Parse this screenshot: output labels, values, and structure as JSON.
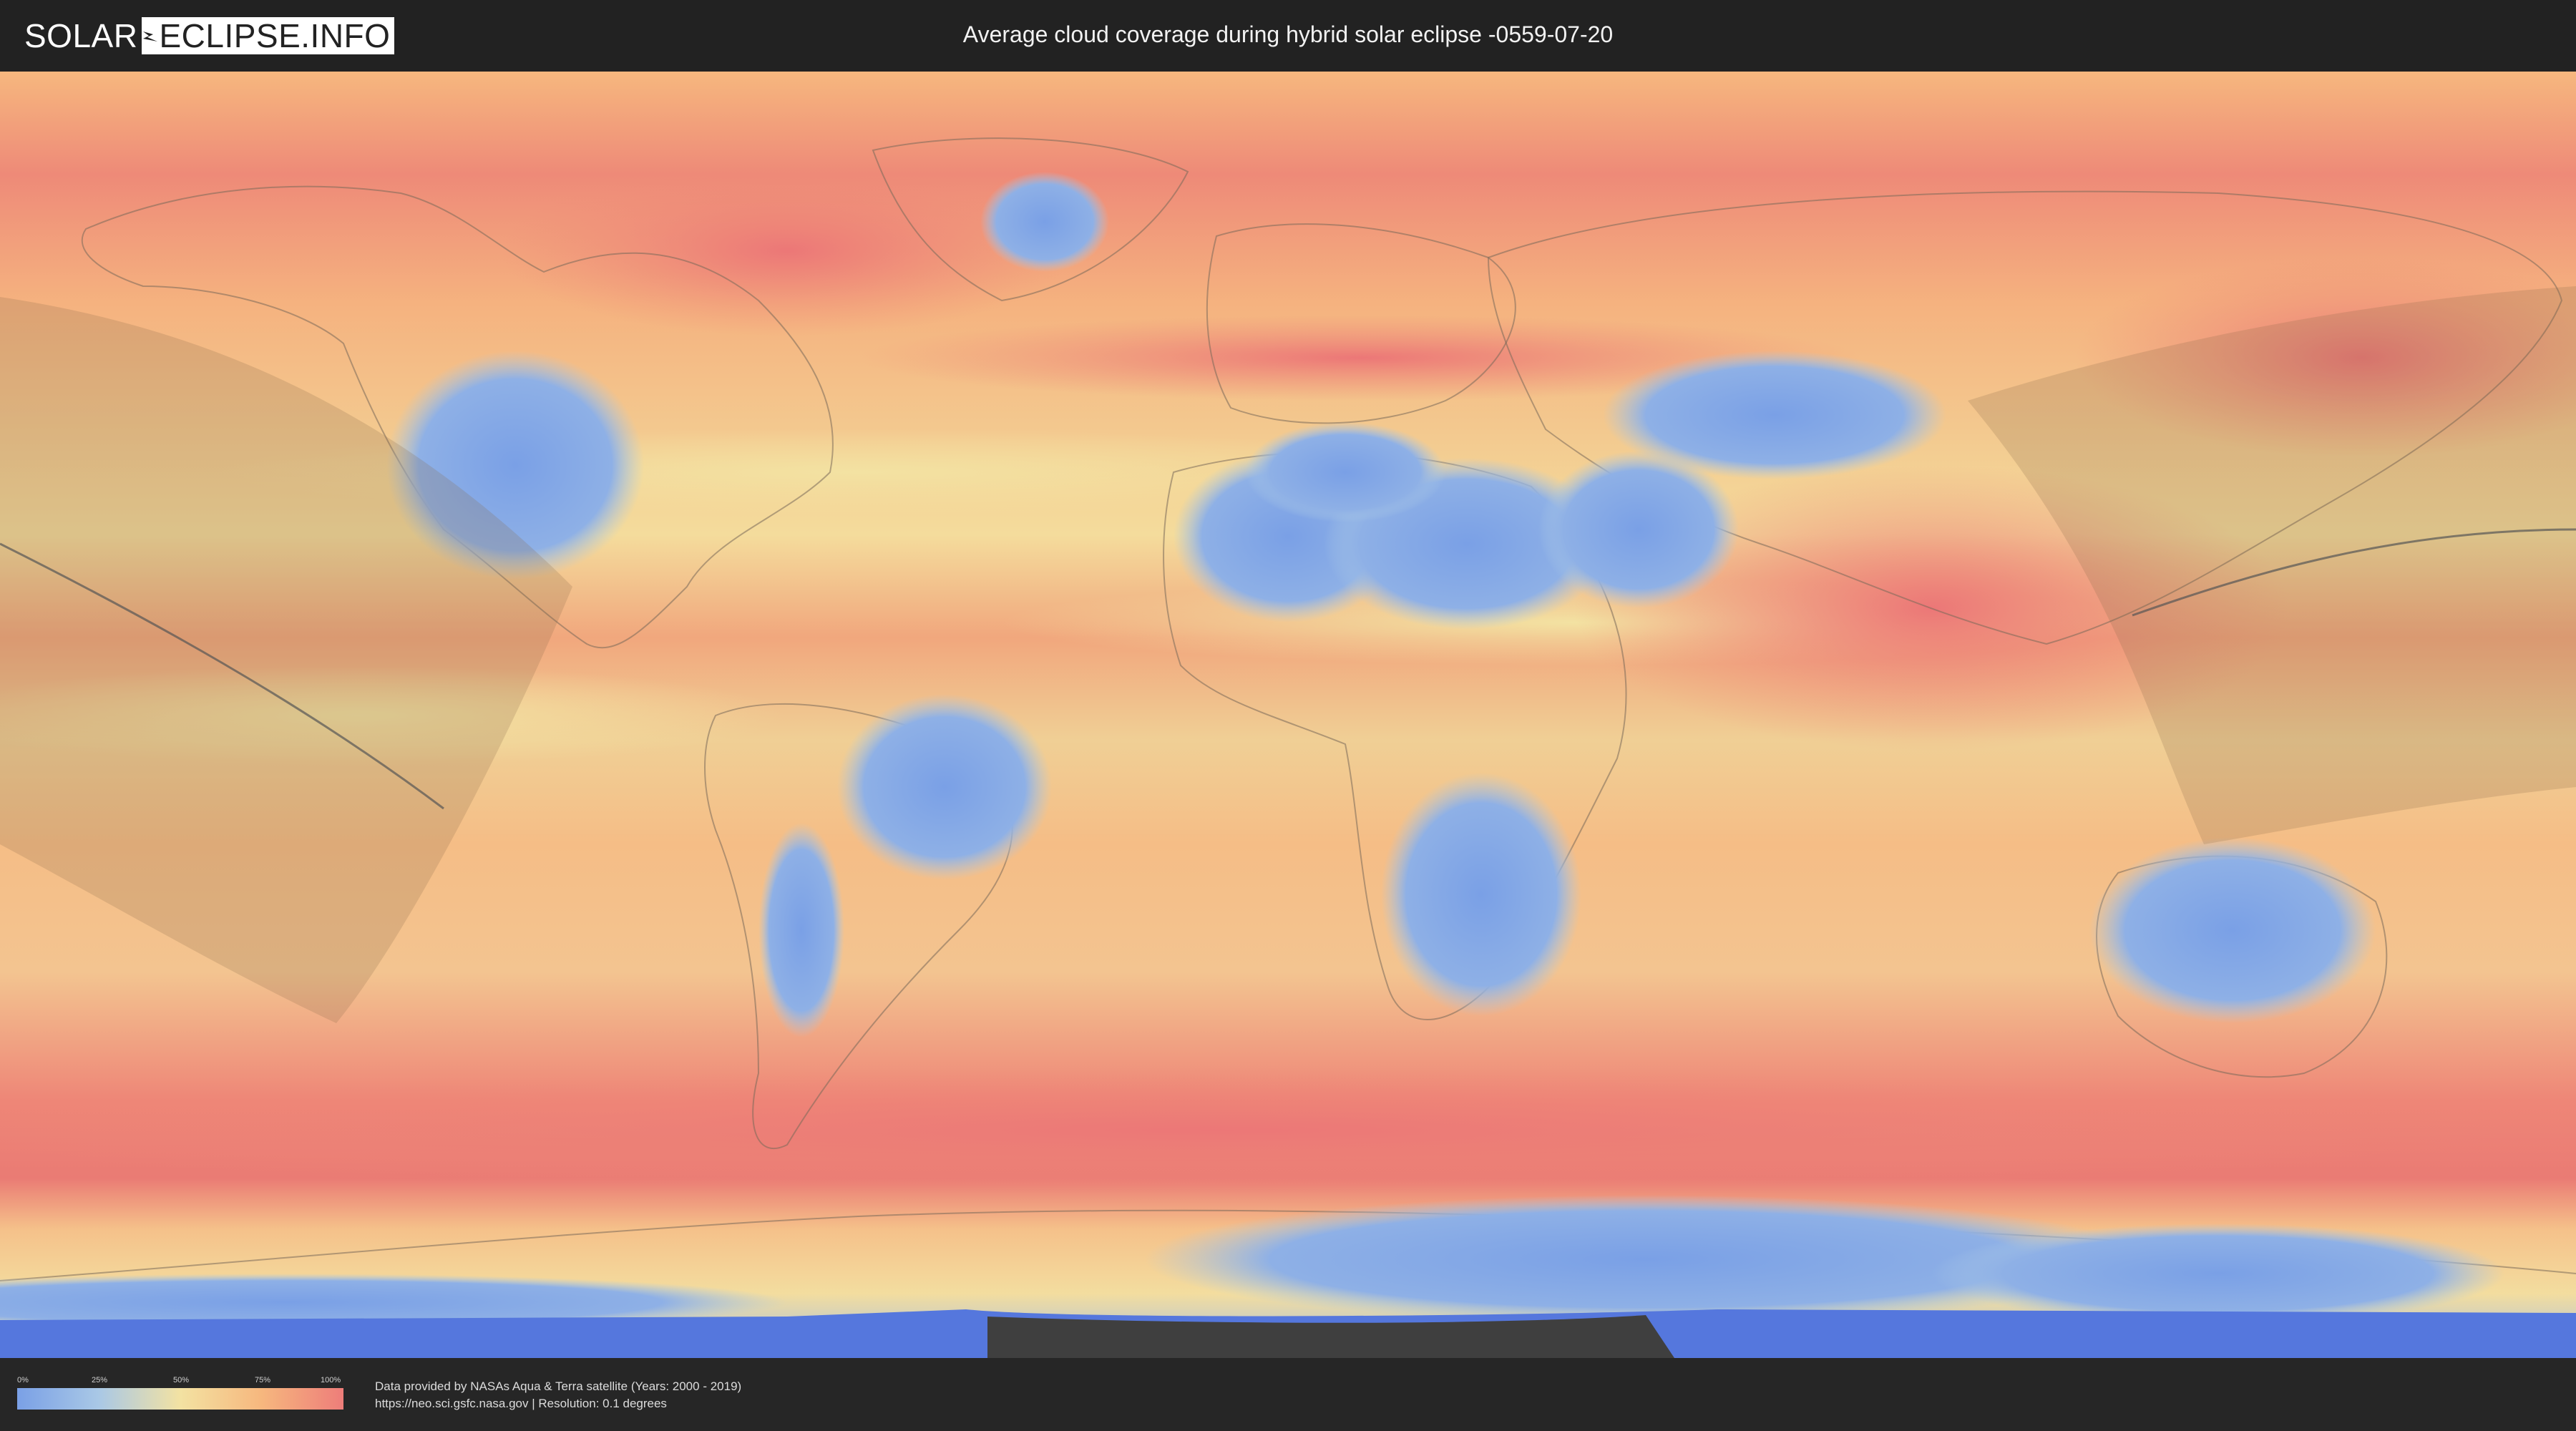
{
  "header": {
    "logo_part1": "SOLAR",
    "logo_part2": "ECLIPSE.INFO",
    "title": "Average cloud coverage during hybrid solar eclipse -0559-07-20"
  },
  "map": {
    "type": "cloud-coverage-world-map",
    "palette": {
      "clear": "#7aa0e6",
      "light": "#a9c8e6",
      "medium": "#f3e2a2",
      "high": "#f6b77e",
      "overcast": "#ee7d7a",
      "background": "#222222",
      "ocean_base": "#f2a37c",
      "eclipse_shadow": "#8a6a4a",
      "path_line": "#555555"
    }
  },
  "legend": {
    "ticks": [
      "0%",
      "25%",
      "50%",
      "75%",
      "100%"
    ]
  },
  "footer": {
    "credit_line1": "Data provided by NASAs Aqua & Terra satellite (Years: 2000 - 2019)",
    "credit_line2": "https://neo.sci.gsfc.nasa.gov | Resolution: 0.1 degrees"
  }
}
